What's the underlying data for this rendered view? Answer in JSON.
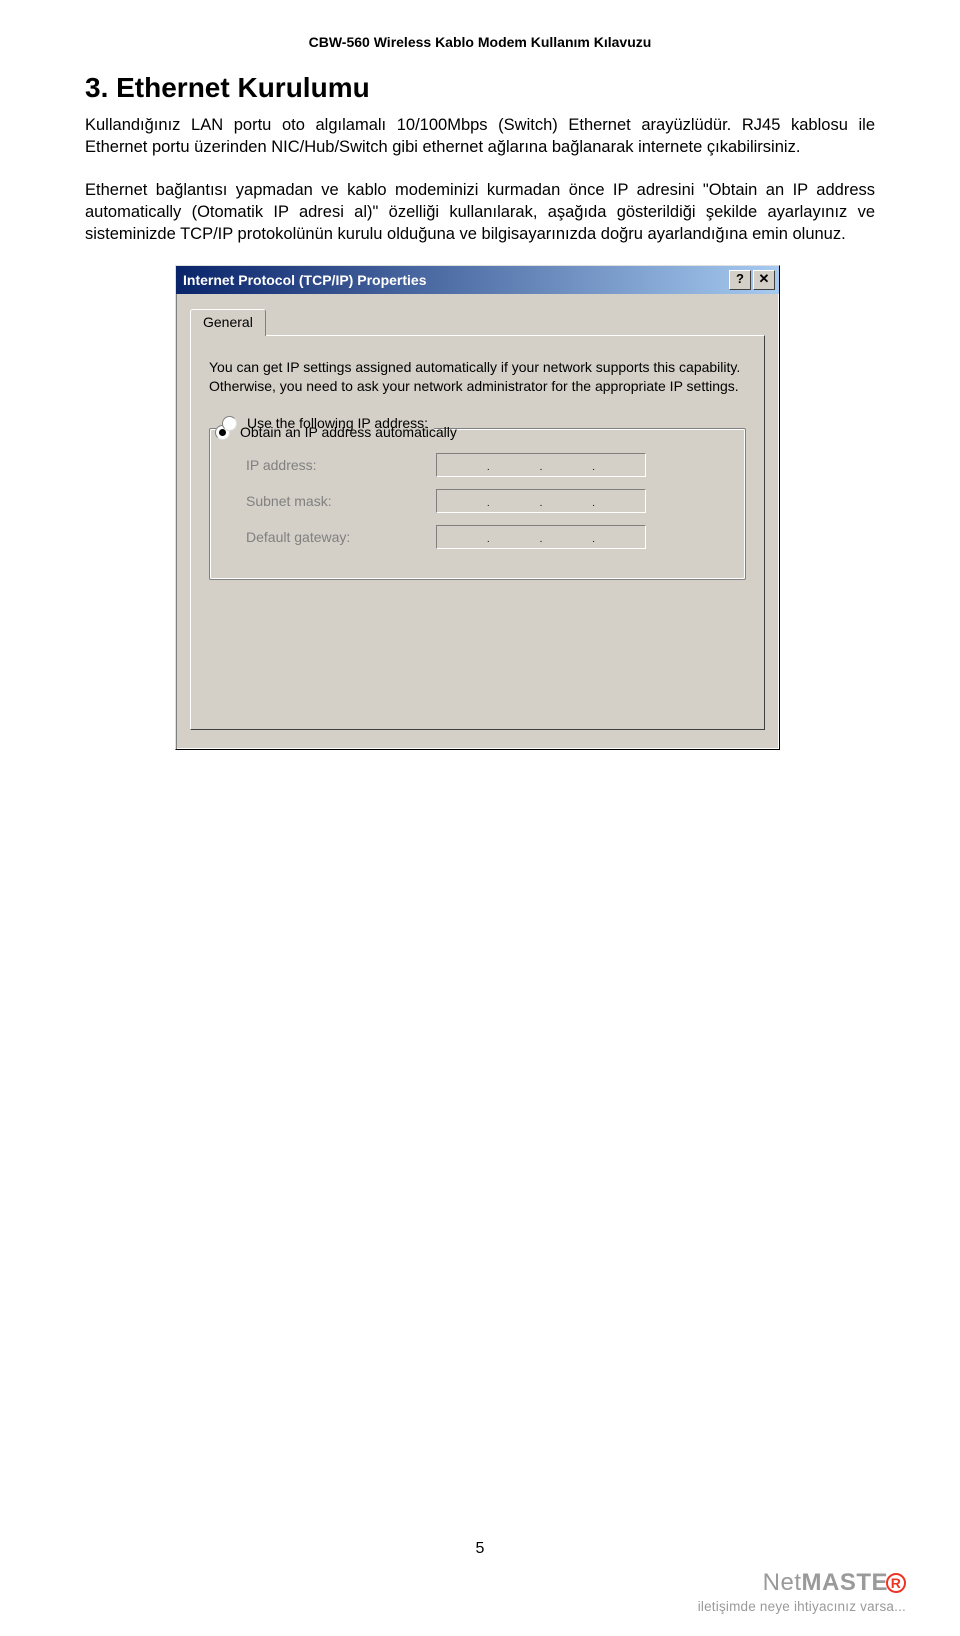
{
  "doc_header": "CBW-560 Wireless Kablo Modem Kullanım Kılavuzu",
  "section_number_title": "3.  Ethernet Kurulumu",
  "paragraph1": "Kullandığınız LAN portu oto algılamalı 10/100Mbps (Switch) Ethernet arayüzlüdür. RJ45 kablosu ile Ethernet portu üzerinden NIC/Hub/Switch gibi ethernet ağlarına bağlanarak internete çıkabilirsiniz.",
  "paragraph2": "Ethernet bağlantısı yapmadan ve kablo modeminizi kurmadan önce IP adresini \"Obtain an IP address automatically (Otomatik IP adresi al)\" özelliği kullanılarak, aşağıda gösterildiği şekilde ayarlayınız ve sisteminizde TCP/IP protokolünün kurulu olduğuna ve bilgisayarınızda doğru ayarlandığına emin olunuz.",
  "dialog": {
    "title": "Internet Protocol (TCP/IP) Properties",
    "help_label": "?",
    "close_label": "✕",
    "tab_label": "General",
    "description": "You can get IP settings assigned automatically if your network supports this capability. Otherwise, you need to ask your network administrator for the appropriate IP settings.",
    "radio_obtain": "Obtain an IP address automatically",
    "radio_use": "Use the following IP address:",
    "field_ip": "IP address:",
    "field_subnet": "Subnet mask:",
    "field_gateway": "Default gateway:"
  },
  "page_number": "5",
  "footer": {
    "brand_net": "Net",
    "brand_master": "MASTE",
    "brand_r": "R",
    "tagline": "iletişimde neye ihtiyacınız varsa..."
  }
}
